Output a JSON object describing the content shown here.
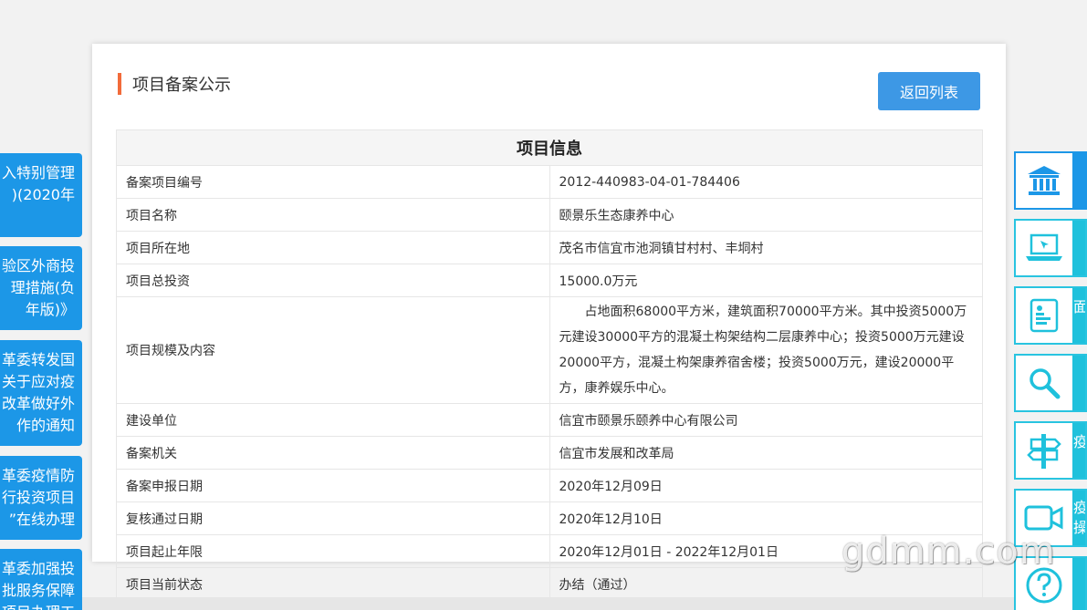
{
  "left_notices": [
    {
      "lines": [
        "入特别管理",
        ")(2020年",
        ""
      ]
    },
    {
      "lines": [
        "验区外商投",
        "理措施(负",
        "年版)》"
      ]
    },
    {
      "lines": [
        "革委转发国",
        "关于应对疫",
        "改革做好外",
        "作的通知"
      ]
    },
    {
      "lines": [
        "革委疫情防",
        "行投资项目",
        "”在线办理"
      ]
    },
    {
      "lines": [
        "革委加强投",
        "批服务保障",
        "项目办理工"
      ]
    }
  ],
  "card": {
    "title": "项目备案公示",
    "back_button": "返回列表",
    "table_caption": "项目信息",
    "rows": [
      {
        "label": "备案项目编号",
        "value": "2012-440983-04-01-784406"
      },
      {
        "label": "项目名称",
        "value": "颐景乐生态康养中心"
      },
      {
        "label": "项目所在地",
        "value": "茂名市信宜市池洞镇甘村村、丰垌村"
      },
      {
        "label": "项目总投资",
        "value": "15000.0万元"
      },
      {
        "label": "项目规模及内容",
        "value": "占地面积68000平方米，建筑面积70000平方米。其中投资5000万元建设30000平方的混凝土构架结构二层康养中心；投资5000万元建设20000平方，混凝土构架康养宿舍楼；投资5000万元，建设20000平方，康养娱乐中心。"
      },
      {
        "label": "建设单位",
        "value": "信宜市颐景乐颐养中心有限公司"
      },
      {
        "label": "备案机关",
        "value": "信宜市发展和改革局"
      },
      {
        "label": "备案申报日期",
        "value": "2020年12月09日"
      },
      {
        "label": "复核通过日期",
        "value": "2020年12月10日"
      },
      {
        "label": "项目起止年限",
        "value": "2020年12月01日 - 2022年12月01日"
      },
      {
        "label": "项目当前状态",
        "value": "办结（通过）"
      }
    ]
  },
  "right_sidebar": [
    {
      "icon": "government-building-icon",
      "text": ""
    },
    {
      "icon": "laptop-icon",
      "text": ""
    },
    {
      "icon": "document-icon",
      "text": "面"
    },
    {
      "icon": "search-icon",
      "text": ""
    },
    {
      "icon": "signpost-icon",
      "text": "疫"
    },
    {
      "icon": "video-camera-icon",
      "text": "疫 操"
    },
    {
      "icon": "help-icon",
      "text": ""
    }
  ],
  "watermark": "gdmm.com",
  "colors": {
    "accent": "#f26b3a",
    "button": "#3d98e5",
    "sidebar": "#1fc1dc",
    "notice": "#1c97e7"
  }
}
